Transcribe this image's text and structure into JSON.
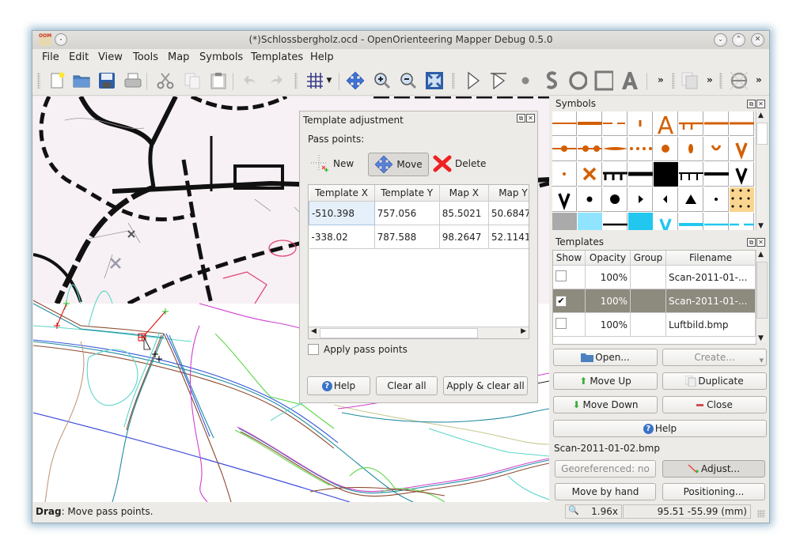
{
  "window": {
    "title": "(*)Schlossbergholz.ocd - OpenOrienteering Mapper Debug 0.5.0",
    "app_icon_text": "OOM",
    "controls": [
      "minimize",
      "maximize",
      "close"
    ]
  },
  "menubar": {
    "items": [
      {
        "label": "File",
        "mnemonic": "F"
      },
      {
        "label": "Edit",
        "mnemonic": "E"
      },
      {
        "label": "View",
        "mnemonic": "V"
      },
      {
        "label": "Tools",
        "mnemonic": "T"
      },
      {
        "label": "Map",
        "mnemonic": "a"
      },
      {
        "label": "Symbols",
        "mnemonic": "y"
      },
      {
        "label": "Templates",
        "mnemonic": "T"
      },
      {
        "label": "Help",
        "mnemonic": "H"
      }
    ]
  },
  "toolbar": {
    "items": [
      "new-file",
      "open-folder",
      "save",
      "print",
      "cut",
      "copy",
      "paste",
      "undo",
      "redo",
      "grid",
      "pan",
      "zoom-in",
      "zoom-out",
      "show-all",
      "edit-tool",
      "edit-line-tool",
      "draw-point",
      "draw-path",
      "draw-circle",
      "draw-rectangle",
      "draw-text",
      "more",
      "duplicate",
      "more",
      "georeferencing",
      "more"
    ],
    "overflow_label": "»"
  },
  "template_adjustment": {
    "title": "Template adjustment",
    "pass_points_label": "Pass points:",
    "tools": {
      "new": "New",
      "move": "Move",
      "delete": "Delete"
    },
    "active_tool": "move",
    "columns": [
      "Template X",
      "Template Y",
      "Map X",
      "Map Y"
    ],
    "rows": [
      [
        "-510.398",
        "757.056",
        "85.5021",
        "50.6847"
      ],
      [
        "-338.02",
        "787.588",
        "98.2647",
        "52.1141"
      ]
    ],
    "apply_pass_points_label": "Apply pass points",
    "apply_pass_points_checked": false,
    "buttons": {
      "help": "Help",
      "clear_all": "Clear all",
      "apply_clear_all": "Apply & clear all"
    }
  },
  "symbols_panel": {
    "title": "Symbols"
  },
  "templates_panel": {
    "title": "Templates",
    "columns": [
      "Show",
      "Opacity",
      "Group",
      "Filename"
    ],
    "rows": [
      {
        "show": false,
        "opacity": "100%",
        "group": "",
        "filename": "Scan-2011-01-..."
      },
      {
        "show": true,
        "opacity": "100%",
        "group": "",
        "filename": "Scan-2011-01-...",
        "selected": true
      },
      {
        "show": false,
        "opacity": "100%",
        "group": "",
        "filename": "Luftbild.bmp"
      }
    ],
    "buttons": {
      "open": "Open...",
      "create": "Create...",
      "move_up": "Move Up",
      "duplicate": "Duplicate",
      "move_down": "Move Down",
      "close": "Close",
      "help": "Help"
    },
    "selected_template_name": "Scan-2011-01-02.bmp",
    "georeferenced_label": "Georeferenced: no",
    "adjust_label": "Adjust...",
    "move_by_hand_label": "Move by hand",
    "positioning_label": "Positioning..."
  },
  "statusbar": {
    "hint_bold": "Drag",
    "hint_text": ": Move pass points.",
    "zoom": "1.96x",
    "coordinates": "95.51 -55.99 (mm)"
  },
  "colors": {
    "window_bg": "#edebe7",
    "selected_row": "#8d8a7e",
    "symbol_orange": "#d35f00",
    "symbol_cyan": "#22c7f0",
    "pass_point_red": "#e00000",
    "pass_point_green": "#20c020"
  }
}
